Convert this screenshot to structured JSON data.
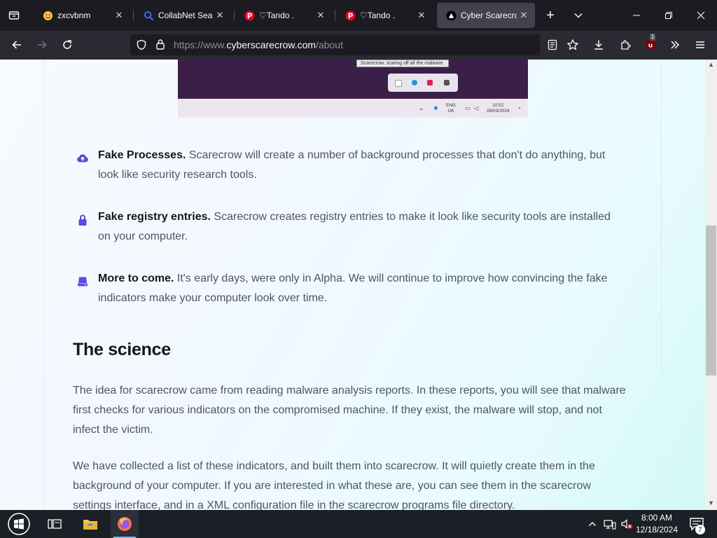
{
  "browser": {
    "tabs": [
      {
        "label": "zxcvbnm",
        "favicon": "emoji-face-icon",
        "active": false
      },
      {
        "label": "CollabNet SearX",
        "favicon": "search-magnifier-icon",
        "active": false
      },
      {
        "label": "♡Tando .",
        "favicon": "pinterest-icon",
        "active": false
      },
      {
        "label": "♡Tando .",
        "favicon": "pinterest-icon",
        "active": false
      },
      {
        "label": "Cyber Scarecrow",
        "favicon": "scarecrow-triangle-icon",
        "active": true
      }
    ],
    "url": {
      "prefix": "https://www.",
      "domain": "cyberscarecrow.com",
      "path": "/about"
    },
    "extension_badge": "1"
  },
  "page": {
    "embedded_screenshot": {
      "tooltip": "Scarecrow, scaring off all the malware.",
      "lang_line1": "ENG",
      "lang_line2": "UK",
      "time": "10:52",
      "date": "28/03/2024"
    },
    "features": [
      {
        "icon": "cloud-upload-icon",
        "title": "Fake Processes.",
        "text": " Scarecrow will create a number of background processes that don't do anything, but look like security research tools."
      },
      {
        "icon": "lock-icon",
        "title": "Fake registry entries.",
        "text": " Scarecrow creates registry entries to make it look like security tools are installed on your computer."
      },
      {
        "icon": "server-icon",
        "title": "More to come.",
        "text": " It's early days, were only in Alpha. We will continue to improve how convincing the fake indicators make your computer look over time."
      }
    ],
    "science_heading": "The science",
    "paragraphs": [
      "The idea for scarecrow came from reading malware analysis reports. In these reports, you will see that malware first checks for various indicators on the compromised machine. If they exist, the malware will stop, and not infect the victim.",
      "We have collected a list of these indicators, and built them into scarecrow. It will quietly create them in the background of your computer. If you are interested in what these are, you can see them in the scarecrow settings interface, and in a XML configuration file in the scarecrow programs file directory."
    ]
  },
  "taskbar": {
    "time": "8:00 AM",
    "date": "12/18/2024",
    "notification_count": "7"
  }
}
